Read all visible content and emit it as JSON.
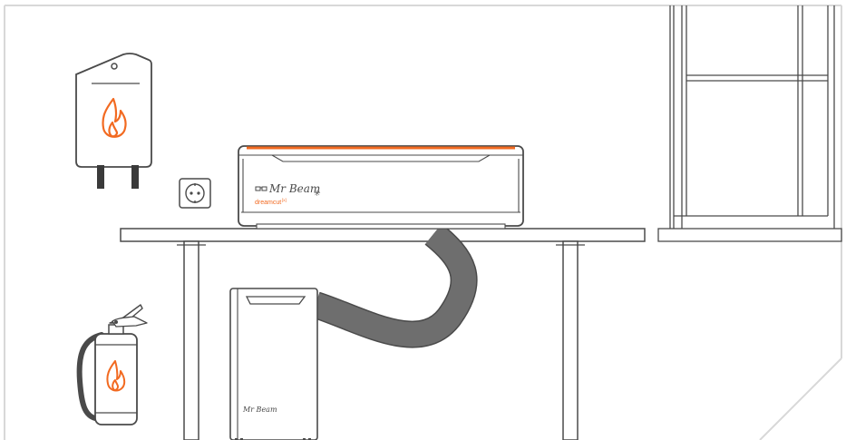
{
  "scene": {
    "colors": {
      "line": "#4a4a4a",
      "accent": "#f26a21",
      "hose": "#6e6e6e",
      "room_border": "#d8d8d8",
      "background": "#ffffff"
    },
    "laser": {
      "brand_script": "Mr Beam",
      "model_label": "dreamcut",
      "model_superscript": "[x]"
    },
    "filter": {
      "brand_script": "Mr Beam"
    },
    "icons": [
      "fire-blanket-icon",
      "flame-icon",
      "power-socket-icon",
      "fire-extinguisher-icon",
      "window-icon"
    ]
  }
}
